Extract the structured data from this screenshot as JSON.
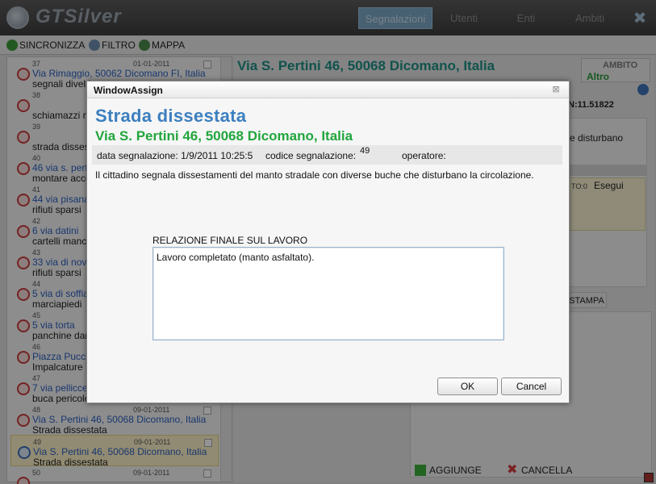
{
  "app": {
    "logo_text": "GTSilver",
    "nav": [
      "Segnalazioni",
      "Utenti",
      "Enti",
      "Ambiti"
    ],
    "close_glyph": "✖"
  },
  "toolbar": {
    "sync_label": "SINCRONIZZA",
    "filter_label": "FILTRO",
    "map_label": "MAPPA"
  },
  "list": [
    {
      "num": "37",
      "date": "01-01-2011",
      "addr": "Via Rimaggio, 50062 Dicomano FI, Italia",
      "desc": "segnali divelti"
    },
    {
      "num": "38",
      "date": "",
      "addr": "",
      "desc": "schiamazzi notturni"
    },
    {
      "num": "39",
      "date": "",
      "addr": "",
      "desc": "strada dissestata"
    },
    {
      "num": "40",
      "date": "",
      "addr": "46 via s. pertini",
      "desc": "montare accessori"
    },
    {
      "num": "41",
      "date": "",
      "addr": "44 via pisana",
      "desc": "rifiuti sparsi"
    },
    {
      "num": "42",
      "date": "",
      "addr": "6 via datini",
      "desc": "cartelli mancanti"
    },
    {
      "num": "43",
      "date": "",
      "addr": "33 via di novoli",
      "desc": "rifiuti sparsi"
    },
    {
      "num": "44",
      "date": "",
      "addr": "5 via di soffiano",
      "desc": "marciapiedi"
    },
    {
      "num": "45",
      "date": "",
      "addr": "5 via torta",
      "desc": "panchine danneggiate"
    },
    {
      "num": "46",
      "date": "",
      "addr": "Piazza Puccini",
      "desc": "Impalcature"
    },
    {
      "num": "47",
      "date": "",
      "addr": "7 via pellicceria",
      "desc": "buca pericolosa"
    },
    {
      "num": "48",
      "date": "09-01-2011",
      "addr": "Via S. Pertini 46, 50068 Dicomano, Italia",
      "desc": "Strada dissestata"
    },
    {
      "num": "49",
      "date": "09-01-2011",
      "addr": "Via S. Pertini 46, 50068 Dicomano, Italia",
      "desc": "Strada dissestata",
      "selected": true
    },
    {
      "num": "50",
      "date": "09-01-2011",
      "addr": "",
      "desc": ""
    }
  ],
  "detail": {
    "title": "Via S. Pertini 46, 50068 Dicomano, Italia",
    "ambito_label": "AMBITO",
    "ambito_value": "Altro",
    "coord": "N:11.51822",
    "snippet": "e disturbano",
    "small_label": "TO:0",
    "esegui_label": "Esegui",
    "stampa_label": "STAMPA",
    "aggiunge_label": "AGGIUNGE",
    "cancella_label": "CANCELLA"
  },
  "dialog": {
    "window_title": "WindowAssign",
    "close_glyph": "⊠",
    "heading": "Strada dissestata",
    "subheading": "Via S. Pertini 46, 50068 Dicomano, Italia",
    "data_label": "data segnalazione: 1/9/2011 10:25:5",
    "codice_label": "codice segnalazione:",
    "codice_value": "49",
    "operatore_label": "operatore:",
    "description": "Il cittadino segnala dissestamenti del manto stradale con diverse buche che disturbano la circolazione.",
    "relazione_label": "RELAZIONE FINALE SUL LAVORO",
    "relazione_value": "Lavoro completato (manto asfaltato).",
    "ok_label": "OK",
    "cancel_label": "Cancel"
  },
  "colors": {
    "heading_blue": "#3c7fbf",
    "address_green": "#22a63d",
    "detail_teal": "#1f8f86",
    "nav_active": "#7aa6c5"
  }
}
